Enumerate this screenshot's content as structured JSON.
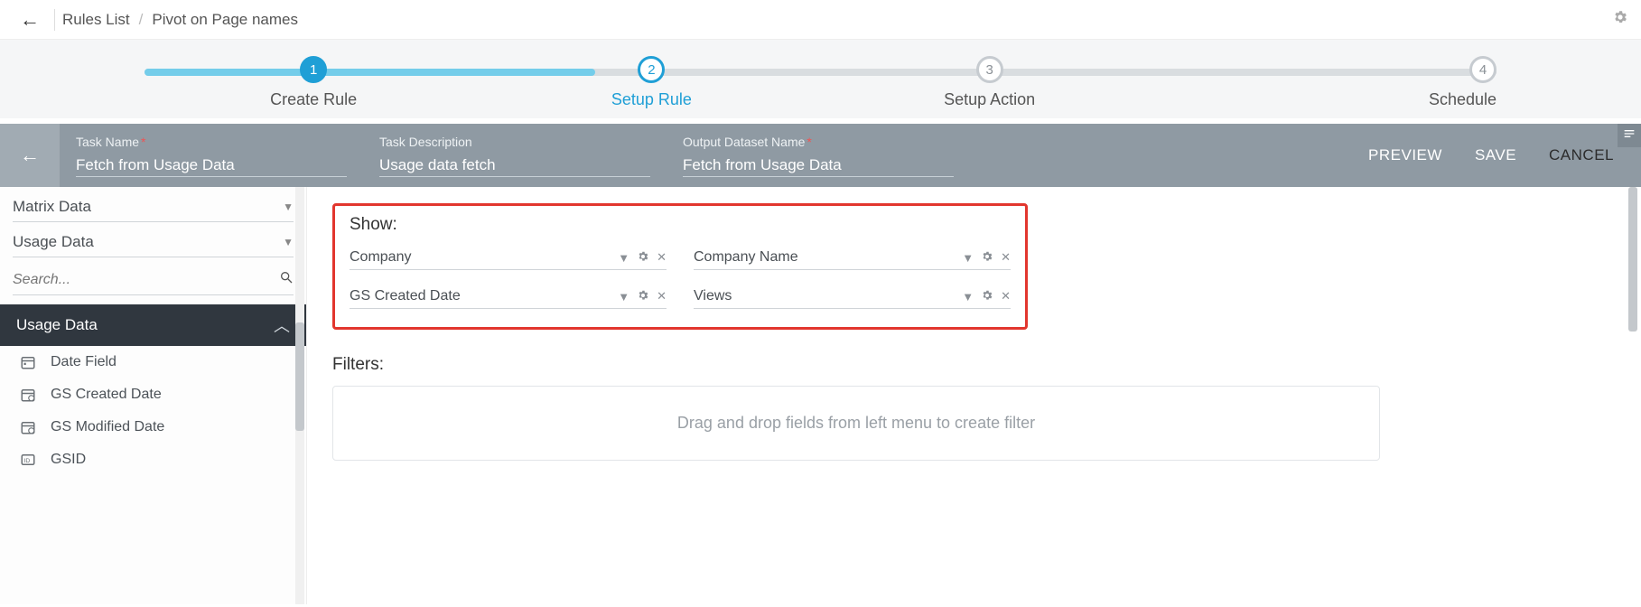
{
  "breadcrumb": {
    "root": "Rules List",
    "current": "Pivot on Page names"
  },
  "stepper": {
    "steps": [
      {
        "num": "1",
        "label": "Create Rule"
      },
      {
        "num": "2",
        "label": "Setup Rule"
      },
      {
        "num": "3",
        "label": "Setup Action"
      },
      {
        "num": "4",
        "label": "Schedule"
      }
    ]
  },
  "taskbar": {
    "task_name_label": "Task Name",
    "task_name_value": "Fetch from Usage Data",
    "task_desc_label": "Task Description",
    "task_desc_value": "Usage data fetch",
    "output_label": "Output Dataset Name",
    "output_value": "Fetch from Usage Data",
    "preview": "PREVIEW",
    "save": "SAVE",
    "cancel": "CANCEL"
  },
  "sidebar": {
    "source1": "Matrix Data",
    "source2": "Usage Data",
    "search_placeholder": "Search...",
    "category": "Usage Data",
    "fields": [
      {
        "label": "Date Field"
      },
      {
        "label": "GS Created Date"
      },
      {
        "label": "GS Modified Date"
      },
      {
        "label": "GSID"
      }
    ]
  },
  "main": {
    "show_label": "Show:",
    "show_fields": [
      {
        "label": "Company"
      },
      {
        "label": "Company Name"
      },
      {
        "label": "GS Created Date"
      },
      {
        "label": "Views"
      }
    ],
    "filters_label": "Filters:",
    "filters_placeholder": "Drag and drop fields from left menu to create filter"
  }
}
